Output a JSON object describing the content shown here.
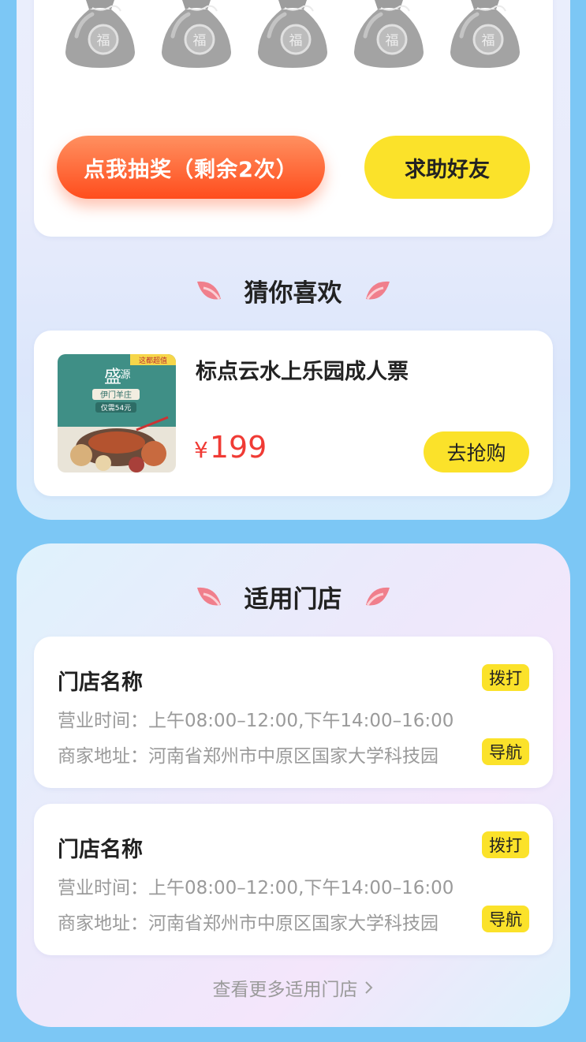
{
  "lottery": {
    "bag_count": 5,
    "bag_label": "福",
    "draw_button": "点我抽奖（剩余2次）",
    "help_button": "求助好友"
  },
  "recommend": {
    "title": "猜你喜欢",
    "product": {
      "name": "标点云水上乐园成人票",
      "currency": "¥",
      "price": "199",
      "buy_button": "去抢购",
      "image_text": {
        "top_banner": "这都超值",
        "brand_main": "盛",
        "brand_sub": "源",
        "dish": "伊门羊庄",
        "price_tag": "仅需54元"
      }
    }
  },
  "stores": {
    "title": "适用门店",
    "items": [
      {
        "name": "门店名称",
        "call_button": "拨打",
        "hours_label": "营业时间：",
        "hours": "上午08:00–12:00,下午14:00–16:00",
        "address_label": "商家地址：",
        "address": "河南省郑州市中原区国家大学科技园",
        "nav_button": "导航"
      },
      {
        "name": "门店名称",
        "call_button": "拨打",
        "hours_label": "营业时间：",
        "hours": "上午08:00–12:00,下午14:00–16:00",
        "address_label": "商家地址：",
        "address": "河南省郑州市中原区国家大学科技园",
        "nav_button": "导航"
      }
    ],
    "more_link": "查看更多适用门店"
  },
  "colors": {
    "page_bg": "#7cc7f5",
    "accent_yellow": "#fbe22a",
    "draw_orange": "#ff4d1d",
    "price_red": "#f03b35",
    "petal_pink": "#f07f8c"
  }
}
